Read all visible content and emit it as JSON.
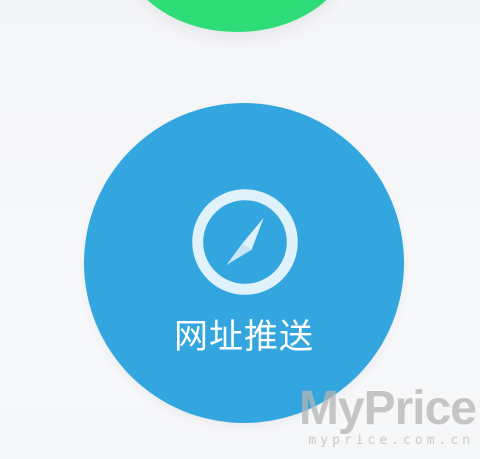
{
  "colors": {
    "green_button": "#2fdd78",
    "blue_button": "#33a6df",
    "icon": "#dff1fb",
    "label_text": "#ffffff",
    "background": "#f6f7f9"
  },
  "top_button": {
    "icon": "none-visible",
    "label": ""
  },
  "main_button": {
    "icon": "compass-icon",
    "label": "网址推送"
  },
  "watermark": {
    "brand": "MyPrice",
    "domain": "myprice.com.cn"
  }
}
